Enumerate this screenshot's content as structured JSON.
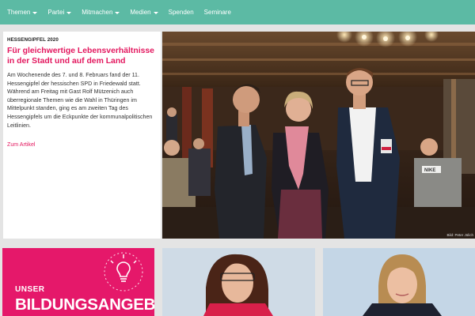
{
  "nav": {
    "items": [
      {
        "label": "Themen",
        "dropdown": true
      },
      {
        "label": "Partei",
        "dropdown": true
      },
      {
        "label": "Mitmachen",
        "dropdown": true
      },
      {
        "label": "Medien",
        "dropdown": true
      },
      {
        "label": "Spenden",
        "dropdown": false
      },
      {
        "label": "Seminare",
        "dropdown": false
      }
    ]
  },
  "article": {
    "kicker": "HESSENGIPFEL 2020",
    "headline": "Für gleichwertige Lebensverhältnisse in der Stadt und auf dem Land",
    "teaser": "Am Wochenende des 7. und 8. Februars fand der 11. Hessengipfel der hessischen SPD in Friedewald statt. Während am Freitag mit Gast Rolf Mützenich auch überregionale Themen wie die Wahl in Thüringen im Mittelpunkt standen, ging es am zweiten Tag des Hessengipfels um die Eckpunkte der kommunalpolitischen Leitlinien.",
    "link_label": "Zum Artikel"
  },
  "hero": {
    "credit": "Bild: Peter Jülich",
    "shirt_text": "NIKE"
  },
  "tiles": {
    "education": {
      "line1": "UNSER",
      "line2": "BILDUNGSANGEBOT"
    }
  },
  "colors": {
    "nav_bg": "#5cbaa4",
    "accent": "#e3185f",
    "tile_pink": "#e5186a",
    "page_bg": "#e4e4e4"
  },
  "icons": [
    "chevron-down-icon",
    "lightbulb-icon"
  ]
}
